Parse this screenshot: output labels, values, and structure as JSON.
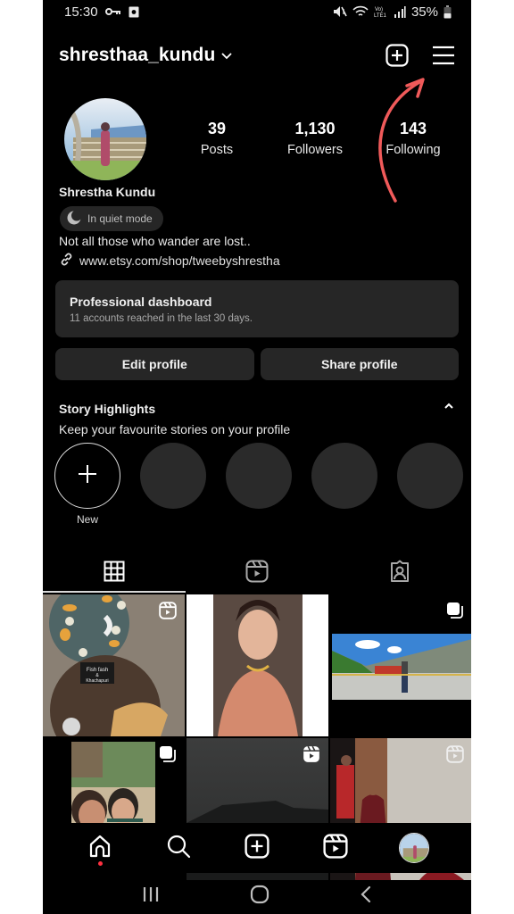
{
  "status_bar": {
    "time": "15:30",
    "left_icons": [
      "key-icon",
      "screenshot-icon"
    ],
    "right_icons": [
      "mute-icon",
      "wifi-icon",
      "volte-icon",
      "signal-icon"
    ],
    "battery": "35%"
  },
  "header": {
    "username": "shresthaa_kundu",
    "actions": [
      "create-icon",
      "menu-icon"
    ]
  },
  "profile": {
    "full_name": "Shrestha Kundu",
    "stats": [
      {
        "value": "39",
        "label": "Posts"
      },
      {
        "value": "1,130",
        "label": "Followers"
      },
      {
        "value": "143",
        "label": "Following"
      }
    ],
    "status_pill": "In quiet mode",
    "bio": "Not all those who wander are lost..",
    "link": "www.etsy.com/shop/tweebyshrestha"
  },
  "dashboard": {
    "title": "Professional dashboard",
    "subtitle": "11 accounts reached in the last 30 days."
  },
  "buttons": {
    "edit": "Edit profile",
    "share": "Share profile"
  },
  "highlights": {
    "title": "Story Highlights",
    "subtitle": "Keep your favourite stories on your profile",
    "new_label": "New",
    "empty_slots": 4
  },
  "tabs": [
    {
      "name": "posts-grid",
      "icon": "grid-icon",
      "active": true
    },
    {
      "name": "reels",
      "icon": "reels-icon",
      "active": false
    },
    {
      "name": "tagged",
      "icon": "tagged-icon",
      "active": false
    }
  ],
  "grid_posts": [
    {
      "type": "reel",
      "description": "food plates",
      "caption": "Fish fash & Khachapuri"
    },
    {
      "type": "photo",
      "description": "portrait"
    },
    {
      "type": "carousel",
      "description": "landscape courtyard"
    },
    {
      "type": "carousel",
      "description": "woman with child"
    },
    {
      "type": "reel",
      "description": "dark sky"
    },
    {
      "type": "reel",
      "description": "monks"
    }
  ],
  "bottom_nav": [
    "home-icon",
    "search-icon",
    "create-icon",
    "reels-icon",
    "profile-avatar"
  ],
  "system_nav": [
    "recents-icon",
    "home-circle-icon",
    "back-icon"
  ],
  "colors": {
    "background": "#000000",
    "surface": "#262626",
    "annotation_arrow": "#f05a5a",
    "notification_dot": "#ff3040"
  }
}
